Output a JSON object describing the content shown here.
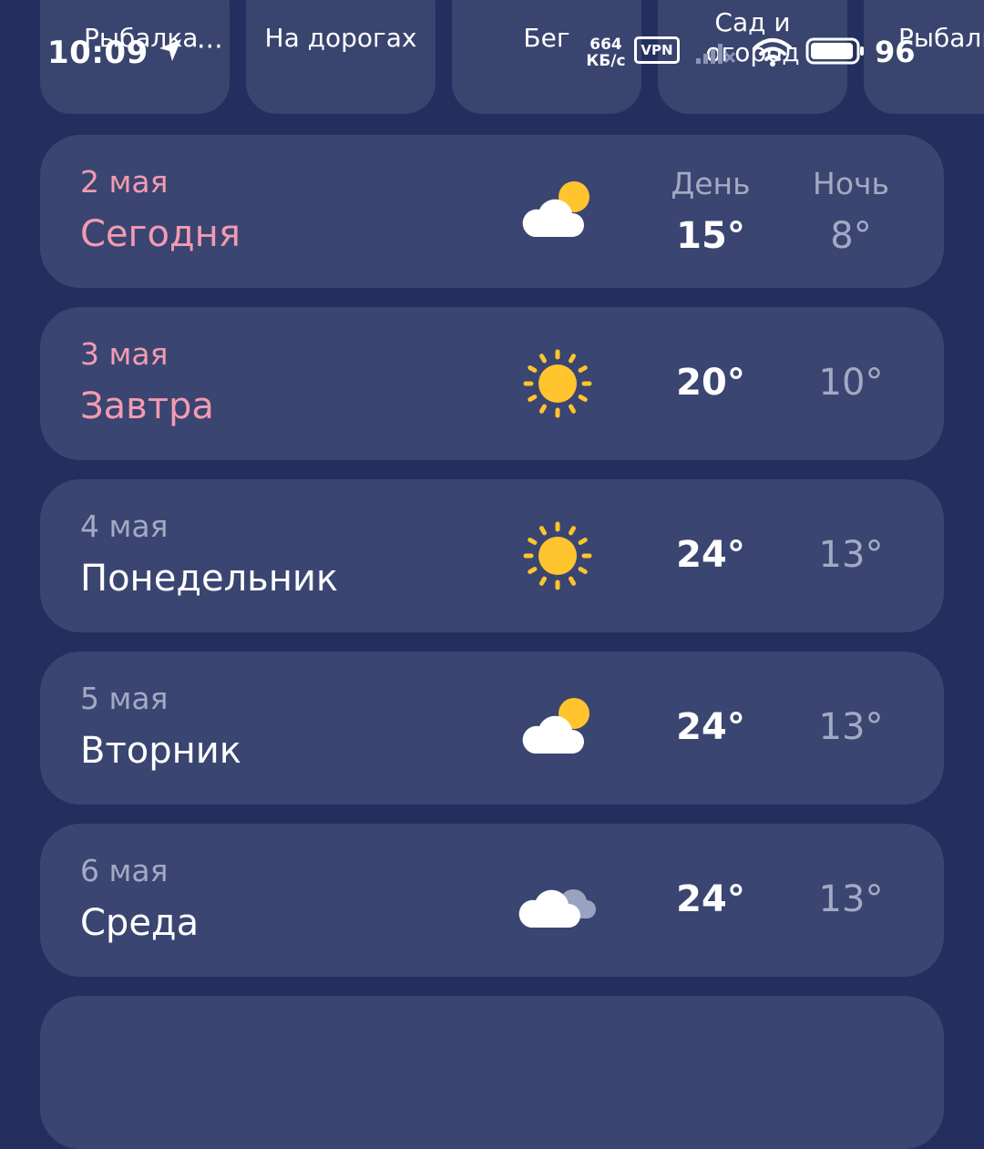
{
  "status_bar": {
    "time": "10:09",
    "more_indicator": "···",
    "net_speed_value": "664",
    "net_speed_unit": "КБ/с",
    "vpn_label": "VPN",
    "battery_percent": "96",
    "battery_level": 0.96
  },
  "categories": [
    {
      "label": "Рыбалка"
    },
    {
      "label": "На дорогах"
    },
    {
      "label": "Бег"
    },
    {
      "label": "Сад и\nогород"
    },
    {
      "label": "Рыбалка"
    }
  ],
  "forecast": {
    "day_label": "День",
    "night_label": "Ночь",
    "days": [
      {
        "date": "2 мая",
        "name": "Сегодня",
        "icon": "partly-cloudy-icon",
        "day_temp": "15°",
        "night_temp": "8°",
        "accent": true
      },
      {
        "date": "3 мая",
        "name": "Завтра",
        "icon": "sun-icon",
        "day_temp": "20°",
        "night_temp": "10°",
        "accent": true
      },
      {
        "date": "4 мая",
        "name": "Понедельник",
        "icon": "sun-icon",
        "day_temp": "24°",
        "night_temp": "13°",
        "accent": false
      },
      {
        "date": "5 мая",
        "name": "Вторник",
        "icon": "partly-cloudy-icon",
        "day_temp": "24°",
        "night_temp": "13°",
        "accent": false
      },
      {
        "date": "6 мая",
        "name": "Среда",
        "icon": "cloudy-icon",
        "day_temp": "24°",
        "night_temp": "13°",
        "accent": false
      }
    ]
  },
  "colors": {
    "background": "#232f5e",
    "card": "#3a4571",
    "accent_text": "#f29bb0",
    "muted_text": "#a3aac3",
    "sun": "#ffc42e"
  }
}
